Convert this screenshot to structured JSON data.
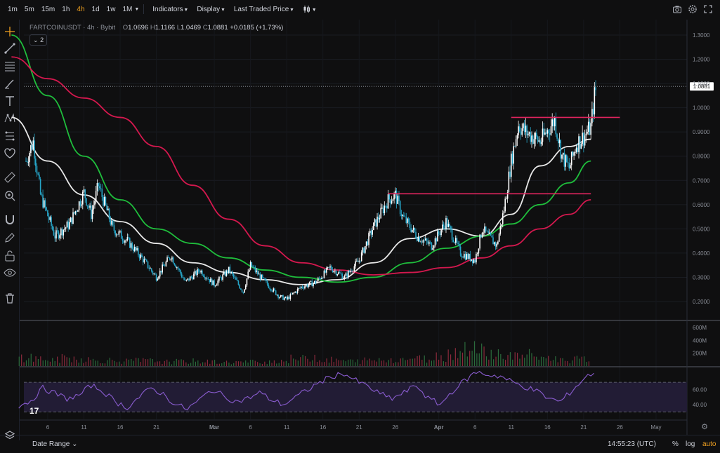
{
  "toolbar": {
    "timeframes": [
      "1m",
      "5m",
      "15m",
      "1h",
      "4h",
      "1d",
      "1w",
      "1M"
    ],
    "active_timeframe": "4h",
    "indicators_label": "Indicators",
    "display_label": "Display",
    "price_source_label": "Last Traded Price",
    "chart_style_icon": "candles-icon",
    "right_icons": [
      "camera-icon",
      "gear-icon",
      "fullscreen-icon"
    ]
  },
  "legend": {
    "symbol": "FARTCOINUSDT",
    "interval": "4h",
    "exchange": "Bybit",
    "open_label": "O",
    "open": "1.0696",
    "high_label": "H",
    "high": "1.1166",
    "low_label": "L",
    "low": "1.0469",
    "close_label": "C",
    "close": "1.0881",
    "change": "+0.0185 (+1.73%)",
    "collapsed_count": "2"
  },
  "bottom": {
    "date_range_label": "Date Range",
    "clock": "14:55:23 (UTC)",
    "percent_label": "%",
    "log_label": "log",
    "auto_label": "auto"
  },
  "colors": {
    "background": "#0f0f10",
    "candle_up": "#ffffff",
    "candle_down": "#26a6c9",
    "ma_fast": "#e8e8e8",
    "ma_mid": "#1fbe3c",
    "ma_slow": "#d4184e",
    "resistance_lines": "#e0245e",
    "rsi_line": "#8a5cd0",
    "rsi_band": "#221c35",
    "accent": "#f0a020"
  },
  "chart_data": [
    {
      "type": "candlestick",
      "title": "FARTCOINUSDT · 4h · Bybit",
      "x_tick_labels": [
        "6",
        "11",
        "16",
        "21",
        "Mar",
        "6",
        "11",
        "16",
        "21",
        "26",
        "Apr",
        "6",
        "11",
        "16",
        "21",
        "26",
        "May"
      ],
      "y_tick_labels": [
        "1.3000",
        "1.2000",
        "1.1000",
        "1.0000",
        "0.9000",
        "0.8000",
        "0.7000",
        "0.6000",
        "0.5000",
        "0.4000",
        "0.3000",
        "0.2000"
      ],
      "ylim": [
        0.15,
        1.35
      ],
      "last_price_label": "1.0881",
      "last_price": 1.0881,
      "price_path": [
        {
          "x": "Feb 3",
          "y": 0.78
        },
        {
          "x": "Feb 4",
          "y": 0.86
        },
        {
          "x": "Feb 5",
          "y": 0.64
        },
        {
          "x": "Feb 7",
          "y": 0.47
        },
        {
          "x": "Feb 9",
          "y": 0.52
        },
        {
          "x": "Feb 11",
          "y": 0.65
        },
        {
          "x": "Feb 12",
          "y": 0.56
        },
        {
          "x": "Feb 13",
          "y": 0.68
        },
        {
          "x": "Feb 15",
          "y": 0.5
        },
        {
          "x": "Feb 17",
          "y": 0.45
        },
        {
          "x": "Feb 19",
          "y": 0.38
        },
        {
          "x": "Feb 21",
          "y": 0.3
        },
        {
          "x": "Feb 23",
          "y": 0.39
        },
        {
          "x": "Feb 25",
          "y": 0.28
        },
        {
          "x": "Feb 27",
          "y": 0.33
        },
        {
          "x": "Mar 1",
          "y": 0.27
        },
        {
          "x": "Mar 3",
          "y": 0.33
        },
        {
          "x": "Mar 5",
          "y": 0.24
        },
        {
          "x": "Mar 6",
          "y": 0.35
        },
        {
          "x": "Mar 8",
          "y": 0.28
        },
        {
          "x": "Mar 10",
          "y": 0.22
        },
        {
          "x": "Mar 11",
          "y": 0.21
        },
        {
          "x": "Mar 13",
          "y": 0.26
        },
        {
          "x": "Mar 15",
          "y": 0.28
        },
        {
          "x": "Mar 17",
          "y": 0.34
        },
        {
          "x": "Mar 19",
          "y": 0.3
        },
        {
          "x": "Mar 21",
          "y": 0.37
        },
        {
          "x": "Mar 23",
          "y": 0.51
        },
        {
          "x": "Mar 25",
          "y": 0.62
        },
        {
          "x": "Mar 26",
          "y": 0.64
        },
        {
          "x": "Mar 27",
          "y": 0.55
        },
        {
          "x": "Mar 29",
          "y": 0.47
        },
        {
          "x": "Mar 31",
          "y": 0.43
        },
        {
          "x": "Apr 2",
          "y": 0.53
        },
        {
          "x": "Apr 4",
          "y": 0.4
        },
        {
          "x": "Apr 6",
          "y": 0.37
        },
        {
          "x": "Apr 7",
          "y": 0.5
        },
        {
          "x": "Apr 9",
          "y": 0.43
        },
        {
          "x": "Apr 10",
          "y": 0.58
        },
        {
          "x": "Apr 11",
          "y": 0.78
        },
        {
          "x": "Apr 12",
          "y": 0.93
        },
        {
          "x": "Apr 13",
          "y": 0.9
        },
        {
          "x": "Apr 15",
          "y": 0.86
        },
        {
          "x": "Apr 17",
          "y": 0.95
        },
        {
          "x": "Apr 18",
          "y": 0.8
        },
        {
          "x": "Apr 19",
          "y": 0.75
        },
        {
          "x": "Apr 20",
          "y": 0.85
        },
        {
          "x": "Apr 21",
          "y": 0.88
        },
        {
          "x": "Apr 22",
          "y": 0.92
        },
        {
          "x": "Apr 22 12h",
          "y": 1.05
        },
        {
          "x": "Apr 22 20h",
          "y": 1.09
        }
      ],
      "series": [
        {
          "name": "MA fast",
          "color": "#e8e8e8",
          "values": [
            {
              "x": "Feb 1",
              "y": 0.96
            },
            {
              "x": "Feb 6",
              "y": 0.78
            },
            {
              "x": "Feb 11",
              "y": 0.64
            },
            {
              "x": "Feb 16",
              "y": 0.53
            },
            {
              "x": "Feb 21",
              "y": 0.44
            },
            {
              "x": "Feb 26",
              "y": 0.36
            },
            {
              "x": "Mar 3",
              "y": 0.32
            },
            {
              "x": "Mar 8",
              "y": 0.29
            },
            {
              "x": "Mar 13",
              "y": 0.27
            },
            {
              "x": "Mar 18",
              "y": 0.29
            },
            {
              "x": "Mar 23",
              "y": 0.36
            },
            {
              "x": "Mar 28",
              "y": 0.46
            },
            {
              "x": "Apr 2",
              "y": 0.5
            },
            {
              "x": "Apr 7",
              "y": 0.47
            },
            {
              "x": "Apr 11",
              "y": 0.56
            },
            {
              "x": "Apr 15",
              "y": 0.76
            },
            {
              "x": "Apr 19",
              "y": 0.84
            },
            {
              "x": "Apr 22",
              "y": 0.87
            }
          ]
        },
        {
          "name": "MA mid",
          "color": "#1fbe3c",
          "values": [
            {
              "x": "Feb 1",
              "y": 1.3
            },
            {
              "x": "Feb 6",
              "y": 1.05
            },
            {
              "x": "Feb 11",
              "y": 0.8
            },
            {
              "x": "Feb 16",
              "y": 0.62
            },
            {
              "x": "Feb 21",
              "y": 0.5
            },
            {
              "x": "Feb 26",
              "y": 0.44
            },
            {
              "x": "Mar 3",
              "y": 0.38
            },
            {
              "x": "Mar 8",
              "y": 0.33
            },
            {
              "x": "Mar 13",
              "y": 0.3
            },
            {
              "x": "Mar 18",
              "y": 0.28
            },
            {
              "x": "Mar 23",
              "y": 0.3
            },
            {
              "x": "Mar 28",
              "y": 0.36
            },
            {
              "x": "Apr 2",
              "y": 0.42
            },
            {
              "x": "Apr 7",
              "y": 0.47
            },
            {
              "x": "Apr 11",
              "y": 0.52
            },
            {
              "x": "Apr 15",
              "y": 0.6
            },
            {
              "x": "Apr 19",
              "y": 0.69
            },
            {
              "x": "Apr 22",
              "y": 0.78
            }
          ]
        },
        {
          "name": "MA slow",
          "color": "#d4184e",
          "values": [
            {
              "x": "Feb 1",
              "y": 1.21
            },
            {
              "x": "Feb 6",
              "y": 1.12
            },
            {
              "x": "Feb 11",
              "y": 1.04
            },
            {
              "x": "Feb 16",
              "y": 0.96
            },
            {
              "x": "Feb 21",
              "y": 0.84
            },
            {
              "x": "Feb 26",
              "y": 0.68
            },
            {
              "x": "Mar 3",
              "y": 0.54
            },
            {
              "x": "Mar 8",
              "y": 0.43
            },
            {
              "x": "Mar 13",
              "y": 0.36
            },
            {
              "x": "Mar 18",
              "y": 0.33
            },
            {
              "x": "Mar 23",
              "y": 0.31
            },
            {
              "x": "Mar 28",
              "y": 0.32
            },
            {
              "x": "Apr 2",
              "y": 0.34
            },
            {
              "x": "Apr 7",
              "y": 0.38
            },
            {
              "x": "Apr 11",
              "y": 0.43
            },
            {
              "x": "Apr 15",
              "y": 0.5
            },
            {
              "x": "Apr 19",
              "y": 0.56
            },
            {
              "x": "Apr 22",
              "y": 0.62
            }
          ]
        }
      ],
      "horizontal_lines": [
        {
          "y": 0.96,
          "from": "Apr 11",
          "to": "Apr 26"
        },
        {
          "y": 0.645,
          "from": "Mar 25",
          "to": "Apr 22"
        }
      ]
    },
    {
      "type": "bar",
      "title": "",
      "y_tick_labels": [
        "600M",
        "400M",
        "200M"
      ],
      "ylim": [
        0,
        700
      ],
      "values": [
        150,
        120,
        100,
        130,
        110,
        90,
        95,
        80,
        90,
        85,
        70,
        75,
        80,
        70,
        60,
        65,
        70,
        75,
        90,
        120,
        150,
        100,
        90,
        80,
        95,
        100,
        110,
        130,
        120,
        160,
        220,
        330,
        250,
        200,
        160,
        180,
        150,
        120,
        100,
        110
      ]
    },
    {
      "type": "line",
      "title": "",
      "y_tick_labels": [
        "60.00",
        "40.00"
      ],
      "ylim": [
        20,
        90
      ],
      "band": [
        30,
        70
      ],
      "values": [
        38,
        45,
        62,
        55,
        48,
        52,
        66,
        58,
        44,
        36,
        50,
        62,
        54,
        40,
        34,
        46,
        60,
        52,
        44,
        48,
        56,
        46,
        40,
        50,
        60,
        70,
        78,
        82,
        72,
        64,
        54,
        48,
        56,
        66,
        48,
        40,
        58,
        72,
        84,
        80,
        78,
        70,
        64,
        58,
        48,
        44,
        60,
        76,
        86
      ]
    }
  ]
}
